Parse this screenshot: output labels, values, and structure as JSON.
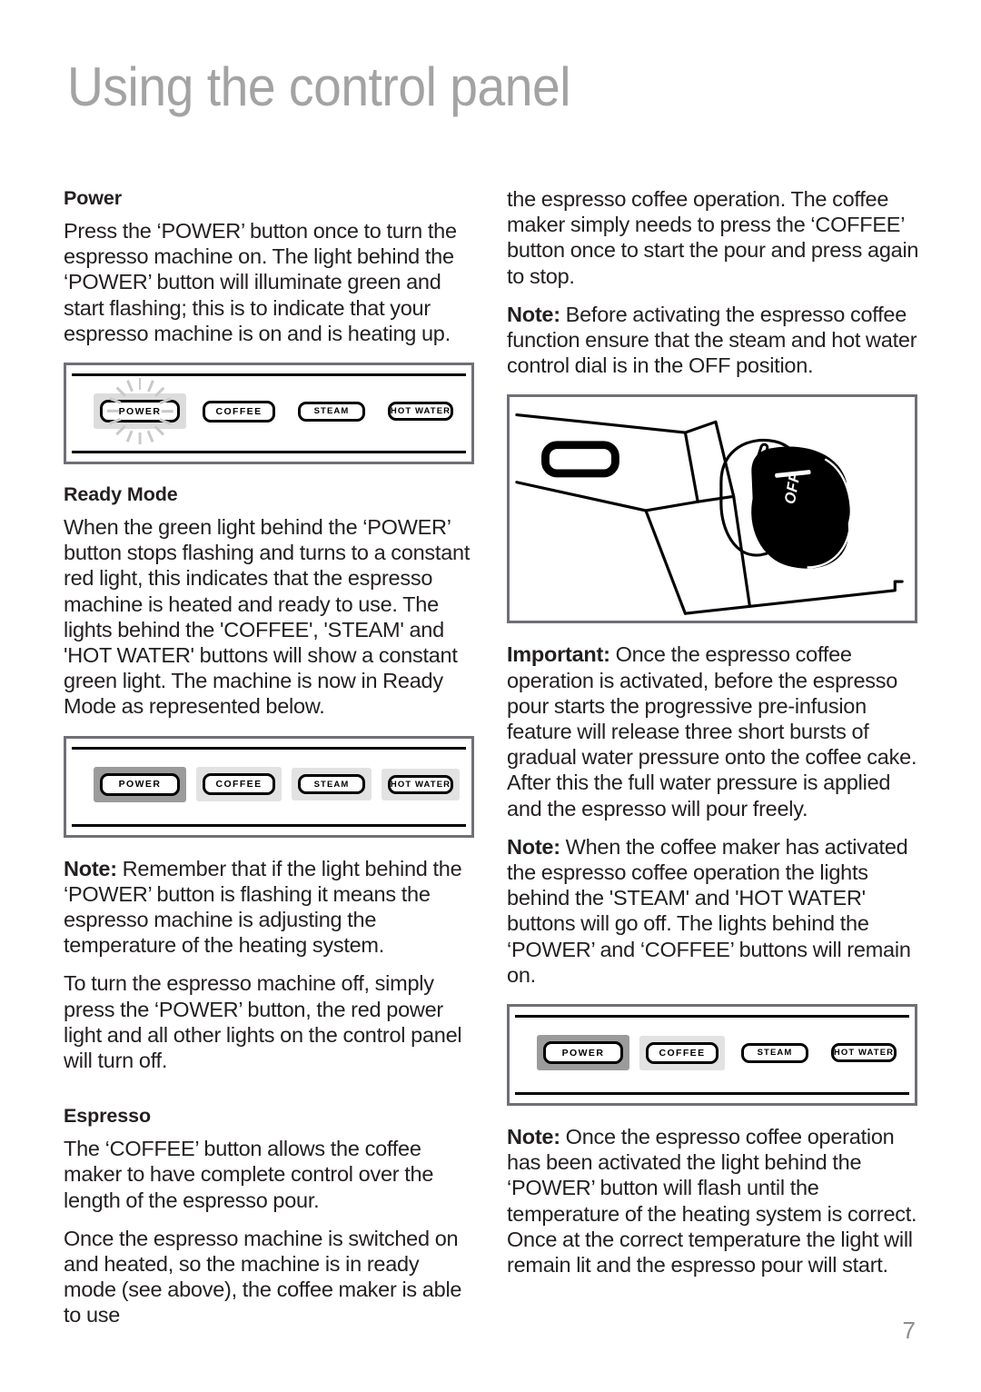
{
  "page": {
    "title": "Using the control panel",
    "number": "7",
    "title_color": "#a3a3a3"
  },
  "left_column": {
    "power": {
      "heading": "Power",
      "paragraph": "Press the ‘POWER’ button once to turn the espresso machine on. The light behind the ‘POWER’ button will illuminate green and start flashing; this is to indicate that your espresso machine is on and is heating up."
    },
    "figure_flashing": {
      "caption_alt": "control panel with flashing POWER light",
      "buttons": [
        {
          "label": "POWER",
          "state": "flashing"
        },
        {
          "label": "COFFEE",
          "state": "off"
        },
        {
          "label": "STEAM",
          "state": "off"
        },
        {
          "label": "HOT WATER",
          "state": "off"
        }
      ]
    },
    "ready_mode": {
      "heading": "Ready Mode",
      "paragraph": "When the green light behind the ‘POWER’ button stops flashing and turns to a constant red light, this indicates that the espresso machine is heated and ready to use. The lights behind the 'COFFEE', 'STEAM' and 'HOT WATER' buttons will show a constant green light.  The machine is now in Ready Mode as represented below."
    },
    "figure_ready": {
      "caption_alt": "control panel in Ready Mode",
      "buttons": [
        {
          "label": "POWER",
          "state": "red"
        },
        {
          "label": "COFFEE",
          "state": "green"
        },
        {
          "label": "STEAM",
          "state": "green"
        },
        {
          "label": "HOT WATER",
          "state": "green"
        }
      ]
    },
    "note_1": {
      "lead": "Note:",
      "text": " Remember that if the light behind the ‘POWER’ button is flashing it means the espresso machine is adjusting the temperature of the heating system."
    },
    "paragraph_off": "To turn the espresso machine off, simply press the ‘POWER’ button, the red power light and all other lights on the control panel will turn off.",
    "espresso": {
      "heading": "Espresso",
      "paragraph_1": "The ‘COFFEE’ button allows the coffee maker to have complete control over the length of the espresso pour.",
      "paragraph_2": "Once the espresso machine is switched on and heated, so the machine is in ready mode (see above), the coffee maker is able to use"
    }
  },
  "right_column": {
    "continued_paragraph": "the espresso coffee operation. The coffee maker simply needs to press the ‘COFFEE’ button once to start the pour and press again to stop.",
    "note_dial": {
      "lead": "Note:",
      "text": " Before activating the espresso coffee function ensure that the steam and hot water control dial is in the OFF position."
    },
    "figure_dial": {
      "caption_alt": "espresso machine steam and hot water control dial",
      "dial_label": "OFF"
    },
    "important": {
      "lead": "Important:",
      "text": " Once the espresso coffee operation is activated, before the espresso pour starts the progressive pre-infusion feature will release three short bursts of gradual water pressure onto the coffee cake.  After this the full water pressure is applied and the espresso will pour freely."
    },
    "note_lights": {
      "lead": "Note:",
      "text": " When the coffee maker has activated the espresso coffee operation the lights behind the 'STEAM' and 'HOT WATER' buttons will go off. The lights behind the ‘POWER’ and ‘COFFEE’ buttons will remain on."
    },
    "figure_brewing": {
      "caption_alt": "control panel during espresso operation",
      "buttons": [
        {
          "label": "POWER",
          "state": "red"
        },
        {
          "label": "COFFEE",
          "state": "green"
        },
        {
          "label": "STEAM",
          "state": "off"
        },
        {
          "label": "HOT WATER",
          "state": "off"
        }
      ]
    },
    "note_flash": {
      "lead": "Note:",
      "text": " Once the espresso coffee operation has been activated the light behind the ‘POWER’ button will flash until the temperature of the heating system is correct. Once at the correct temperature the light will remain lit and the espresso pour will start."
    }
  },
  "colors": {
    "panel_border": "#6f6f78",
    "light_red": "#9b9b9b",
    "light_green": "#e2e2e2",
    "light_flash": "#dcdcdc",
    "ink": "#231f20"
  }
}
